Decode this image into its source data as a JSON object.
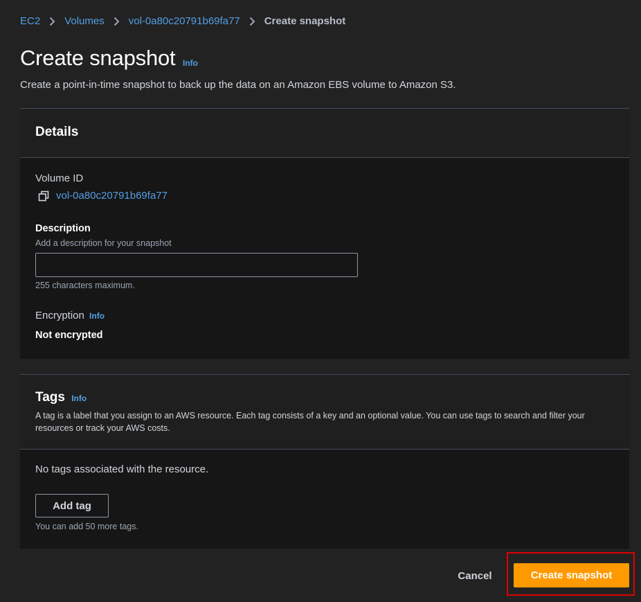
{
  "breadcrumb": {
    "items": [
      "EC2",
      "Volumes",
      "vol-0a80c20791b69fa77"
    ],
    "current": "Create snapshot"
  },
  "page": {
    "title": "Create snapshot",
    "info": "Info",
    "description": "Create a point-in-time snapshot to back up the data on an Amazon EBS volume to Amazon S3."
  },
  "details": {
    "heading": "Details",
    "volume_id_label": "Volume ID",
    "volume_id": "vol-0a80c20791b69fa77",
    "description_label": "Description",
    "description_hint": "Add a description for your snapshot",
    "description_value": "",
    "description_constraint": "255 characters maximum.",
    "encryption_label": "Encryption",
    "encryption_info": "Info",
    "encryption_value": "Not encrypted"
  },
  "tags": {
    "heading": "Tags",
    "info": "Info",
    "description": "A tag is a label that you assign to an AWS resource. Each tag consists of a key and an optional value. You can use tags to search and filter your resources or track your AWS costs.",
    "empty": "No tags associated with the resource.",
    "add_button": "Add tag",
    "limit": "You can add 50 more tags."
  },
  "footer": {
    "cancel": "Cancel",
    "submit": "Create snapshot"
  },
  "colors": {
    "link": "#539fe5",
    "primary": "#ff9900",
    "highlight": "#e00000",
    "background": "#222222",
    "panel": "#161616"
  },
  "icons": [
    "chevron-right-icon",
    "copy-icon"
  ]
}
